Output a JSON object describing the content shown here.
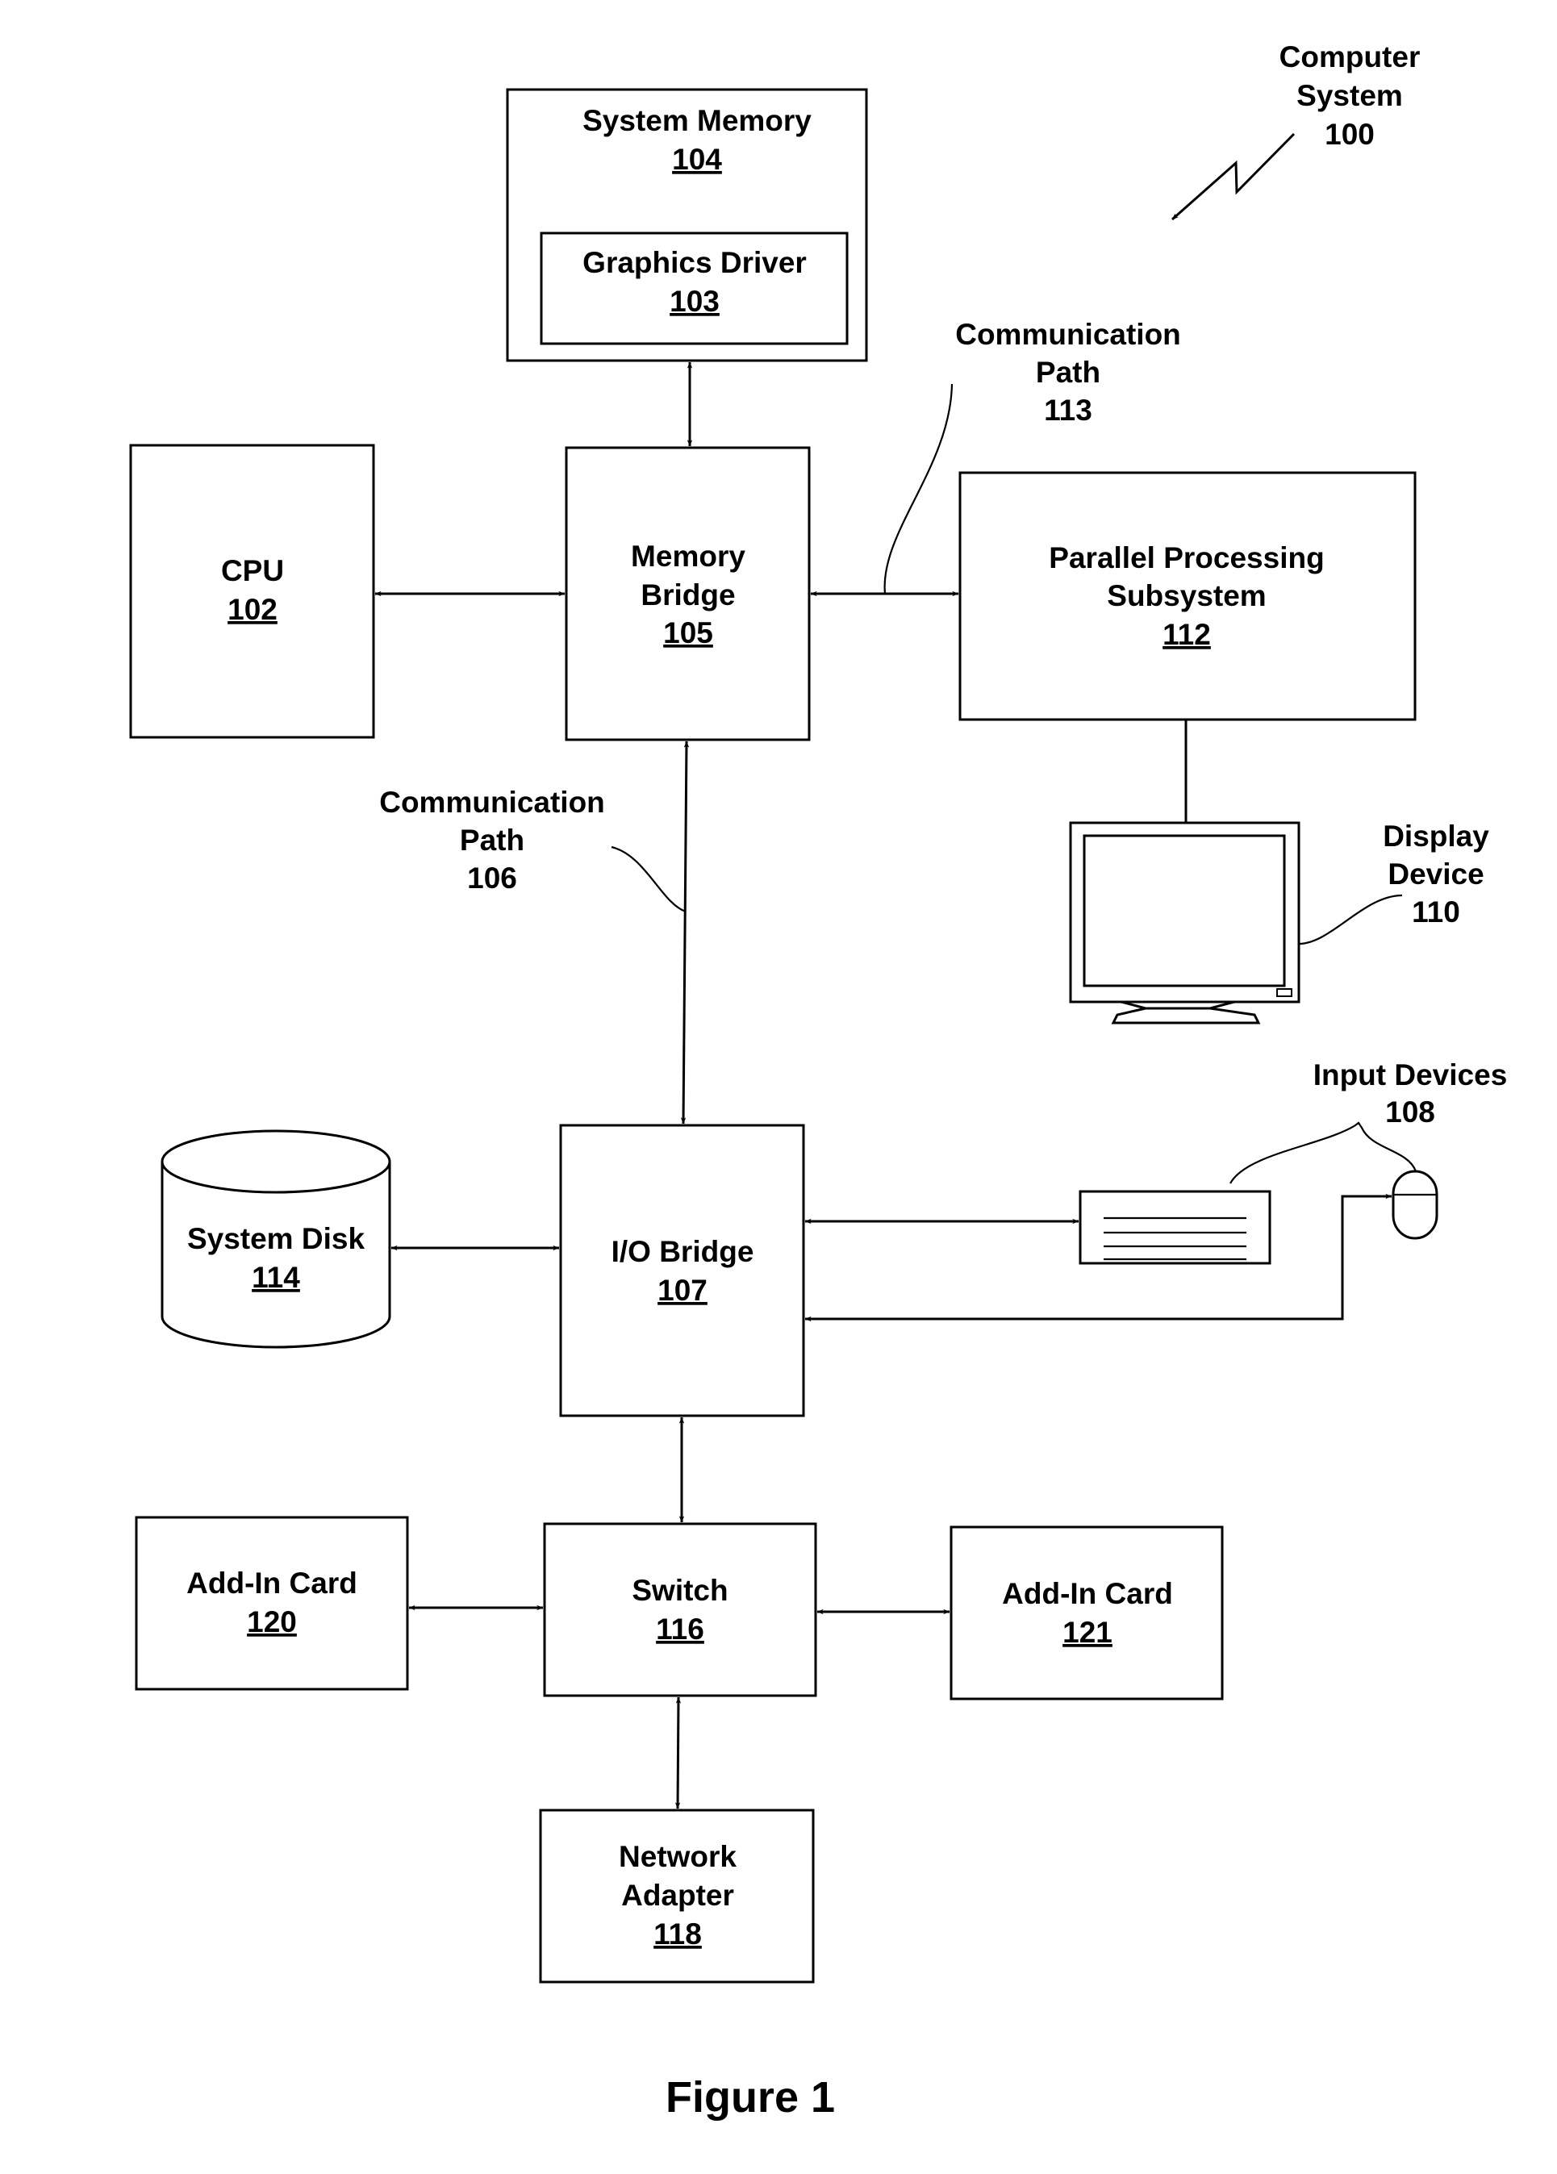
{
  "figure_caption": "Figure 1",
  "title_label": {
    "line1": "Computer",
    "line2": "System",
    "ref": "100"
  },
  "components": {
    "system_memory": {
      "lines": [
        "System Memory"
      ],
      "ref": "104"
    },
    "graphics_driver": {
      "lines": [
        "Graphics Driver"
      ],
      "ref": "103"
    },
    "cpu": {
      "lines": [
        "CPU"
      ],
      "ref": "102"
    },
    "memory_bridge": {
      "lines": [
        "Memory",
        "Bridge"
      ],
      "ref": "105"
    },
    "parallel_processing": {
      "lines": [
        "Parallel Processing",
        "Subsystem"
      ],
      "ref": "112"
    },
    "io_bridge": {
      "lines": [
        "I/O Bridge"
      ],
      "ref": "107"
    },
    "system_disk": {
      "lines": [
        "System Disk"
      ],
      "ref": "114"
    },
    "switch": {
      "lines": [
        "Switch"
      ],
      "ref": "116"
    },
    "add_in_card_120": {
      "lines": [
        "Add-In Card"
      ],
      "ref": "120"
    },
    "add_in_card_121": {
      "lines": [
        "Add-In Card"
      ],
      "ref": "121"
    },
    "network_adapter": {
      "lines": [
        "Network",
        "Adapter"
      ],
      "ref": "118"
    }
  },
  "callouts": {
    "comm_path_113": {
      "lines": [
        "Communication",
        "Path"
      ],
      "ref": "113"
    },
    "comm_path_106": {
      "lines": [
        "Communication",
        "Path"
      ],
      "ref": "106"
    },
    "display_device": {
      "lines": [
        "Display",
        "Device"
      ],
      "ref": "110"
    },
    "input_devices": {
      "lines": [
        "Input Devices"
      ],
      "ref": "108"
    }
  },
  "connections": [
    {
      "from": "System Memory 104",
      "to": "Memory Bridge 105",
      "type": "bidirectional"
    },
    {
      "from": "CPU 102",
      "to": "Memory Bridge 105",
      "type": "bidirectional"
    },
    {
      "from": "Memory Bridge 105",
      "to": "Parallel Processing Subsystem 112",
      "type": "bidirectional",
      "label": "Communication Path 113"
    },
    {
      "from": "Parallel Processing Subsystem 112",
      "to": "Display Device 110",
      "type": "line"
    },
    {
      "from": "Memory Bridge 105",
      "to": "I/O Bridge 107",
      "type": "bidirectional",
      "label": "Communication Path 106"
    },
    {
      "from": "System Disk 114",
      "to": "I/O Bridge 107",
      "type": "bidirectional"
    },
    {
      "from": "I/O Bridge 107",
      "to": "Keyboard (Input Devices 108)",
      "type": "bidirectional"
    },
    {
      "from": "Mouse (Input Devices 108)",
      "to": "I/O Bridge 107",
      "type": "bidirectional"
    },
    {
      "from": "I/O Bridge 107",
      "to": "Switch 116",
      "type": "bidirectional"
    },
    {
      "from": "Add-In Card 120",
      "to": "Switch 116",
      "type": "bidirectional"
    },
    {
      "from": "Switch 116",
      "to": "Add-In Card 121",
      "type": "bidirectional"
    },
    {
      "from": "Switch 116",
      "to": "Network Adapter 118",
      "type": "bidirectional"
    }
  ]
}
